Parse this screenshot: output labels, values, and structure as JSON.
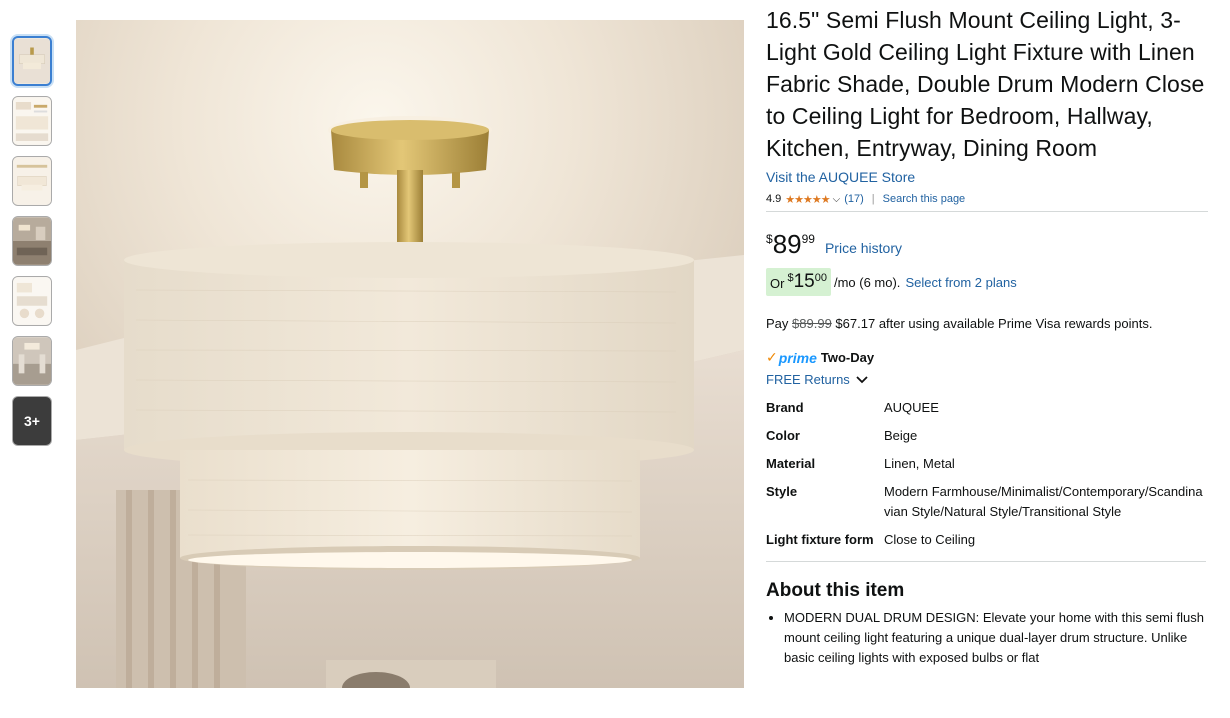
{
  "thumbnails": {
    "more_label": "3+"
  },
  "product": {
    "title": "16.5\" Semi Flush Mount Ceiling Light, 3-Light Gold Ceiling Light Fixture with Linen Fabric Shade, Double Drum Modern Close to Ceiling Light for Bedroom, Hallway, Kitchen, Entryway, Dining Room",
    "store_link": "Visit the AUQUEE Store",
    "rating": "4.9",
    "stars": "★★★★★",
    "review_count": "(17)",
    "search_page": "Search this page"
  },
  "price": {
    "currency": "$",
    "whole": "89",
    "fraction": "99",
    "history_link": "Price history"
  },
  "plan": {
    "or": "Or",
    "currency": "$",
    "whole": "15",
    "fraction": "00",
    "per_month": "/mo (6 mo).",
    "select_plans": "Select from 2 plans"
  },
  "pay": {
    "prefix": "Pay",
    "old_price": "$89.99",
    "new_price": "$67.17",
    "suffix": "after using available Prime Visa rewards points."
  },
  "delivery": {
    "prime_label": "prime",
    "two_day": "Two-Day",
    "free_returns": "FREE Returns"
  },
  "specs": [
    {
      "key": "Brand",
      "value": "AUQUEE"
    },
    {
      "key": "Color",
      "value": "Beige"
    },
    {
      "key": "Material",
      "value": "Linen, Metal"
    },
    {
      "key": "Style",
      "value": "Modern Farmhouse/Minimalist/Contemporary/Scandinavian Style/Natural Style/Transitional Style"
    },
    {
      "key": "Light fixture form",
      "value": "Close to Ceiling"
    }
  ],
  "about": {
    "heading": "About this item",
    "bullets": [
      "MODERN DUAL DRUM DESIGN: Elevate your home with this semi flush mount ceiling light featuring a unique dual-layer drum structure. Unlike basic ceiling lights with exposed bulbs or flat"
    ]
  },
  "colors": {
    "link": "#2162a1",
    "star": "#de7921",
    "plan_badge": "#d5f1d2",
    "prime": "#1a98ff"
  }
}
